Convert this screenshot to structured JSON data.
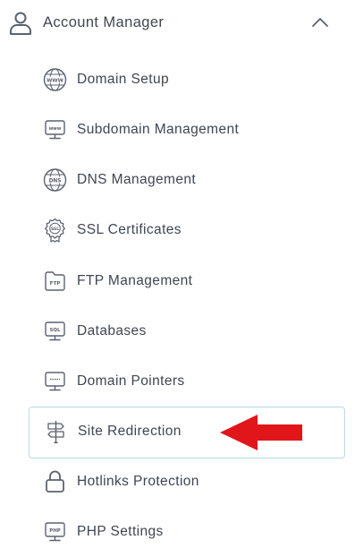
{
  "header": {
    "title": "Account Manager",
    "user_icon": "user-icon",
    "toggle_icon": "chevron-up-icon"
  },
  "menu": {
    "items": [
      {
        "label": "Domain Setup",
        "icon": "www-globe-icon",
        "active": false
      },
      {
        "label": "Subdomain Management",
        "icon": "www-monitor-icon",
        "active": false
      },
      {
        "label": "DNS Management",
        "icon": "dns-globe-icon",
        "active": false
      },
      {
        "label": "SSL Certificates",
        "icon": "ssl-badge-icon",
        "active": false
      },
      {
        "label": "FTP Management",
        "icon": "ftp-folder-icon",
        "active": false
      },
      {
        "label": "Databases",
        "icon": "sql-monitor-icon",
        "active": false
      },
      {
        "label": "Domain Pointers",
        "icon": "pointer-monitor-icon",
        "active": false
      },
      {
        "label": "Site Redirection",
        "icon": "signpost-icon",
        "active": true
      },
      {
        "label": "Hotlinks Protection",
        "icon": "lock-icon",
        "active": false
      },
      {
        "label": "PHP Settings",
        "icon": "php-monitor-icon",
        "active": false
      }
    ]
  },
  "annotation": {
    "icon": "red-arrow-pointer-icon",
    "color": "#e0161b"
  },
  "colors": {
    "text": "#3f4652",
    "icon": "#5a6270",
    "active_border": "#b9dbe4"
  }
}
